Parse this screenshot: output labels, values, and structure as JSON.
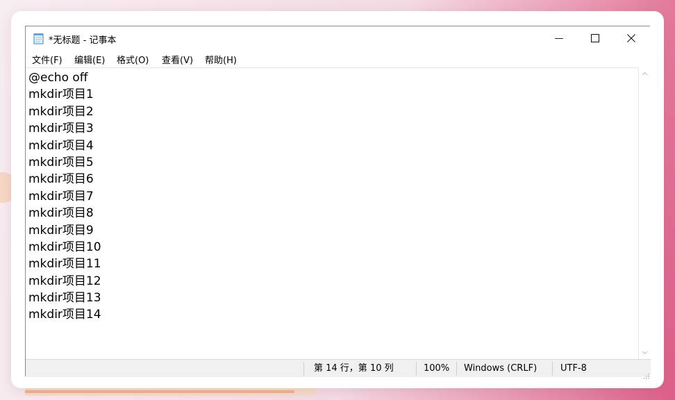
{
  "window": {
    "title": "*无标题 - 记事本",
    "minimize_glyph": "—",
    "maximize_glyph": "☐",
    "close_glyph": "✕"
  },
  "menu": [
    {
      "label": "文件(F)"
    },
    {
      "label": "编辑(E)"
    },
    {
      "label": "格式(O)"
    },
    {
      "label": "查看(V)"
    },
    {
      "label": "帮助(H)"
    }
  ],
  "editor": {
    "lines": [
      "@echo off",
      "mkdir项目1",
      "mkdir项目2",
      "mkdir项目3",
      "mkdir项目4",
      "mkdir项目5",
      "mkdir项目6",
      "mkdir项目7",
      "mkdir项目8",
      "mkdir项目9",
      "mkdir项目10",
      "mkdir项目11",
      "mkdir项目12",
      "mkdir项目13",
      "mkdir项目14"
    ]
  },
  "status": {
    "position": "第 14 行，第 10 列",
    "zoom": "100%",
    "line_ending": "Windows (CRLF)",
    "encoding": "UTF-8"
  },
  "icons": {
    "app": "notepad-icon",
    "scroll_up": "chevron-up-icon",
    "scroll_down": "chevron-down-icon",
    "grip": "resize-grip-icon"
  },
  "colors": {
    "text": "#000000",
    "statusbar_bg": "#f0f0f0",
    "background_accent": "#dc5f88"
  }
}
